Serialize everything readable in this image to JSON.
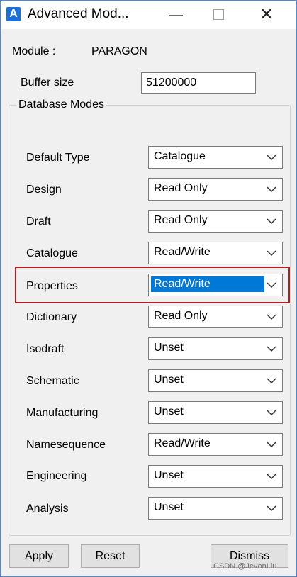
{
  "window": {
    "title": "Advanced Mod..."
  },
  "module": {
    "label": "Module :",
    "value": "PARAGON"
  },
  "buffer": {
    "label": "Buffer size",
    "value": "51200000"
  },
  "group": {
    "title": "Database Modes"
  },
  "rows": [
    {
      "label": "Default Type",
      "value": "Catalogue"
    },
    {
      "label": "Design",
      "value": "Read Only"
    },
    {
      "label": "Draft",
      "value": "Read Only"
    },
    {
      "label": "Catalogue",
      "value": "Read/Write"
    },
    {
      "label": "Properties",
      "value": "Read/Write"
    },
    {
      "label": "Dictionary",
      "value": "Read Only"
    },
    {
      "label": "Isodraft",
      "value": "Unset"
    },
    {
      "label": "Schematic",
      "value": "Unset"
    },
    {
      "label": "Manufacturing",
      "value": "Unset"
    },
    {
      "label": "Namesequence",
      "value": "Read/Write"
    },
    {
      "label": "Engineering",
      "value": "Unset"
    },
    {
      "label": "Analysis",
      "value": "Unset"
    }
  ],
  "buttons": {
    "apply": "Apply",
    "reset": "Reset",
    "dismiss": "Dismiss"
  },
  "watermark": "CSDN @JevonLiu",
  "colors": {
    "selection": "#0078d7",
    "highlight_border": "#b02020"
  },
  "icons": {
    "app": "app-logo-icon",
    "minimize": "minimize-icon",
    "maximize": "maximize-icon",
    "close": "close-icon",
    "dropdown": "chevron-down-icon"
  }
}
